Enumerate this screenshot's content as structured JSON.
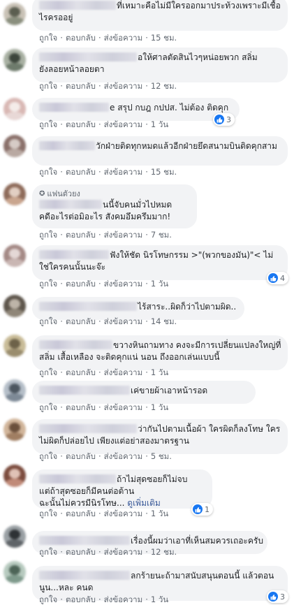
{
  "actions": {
    "like": "ถูกใจ",
    "reply": "ตอบกลับ",
    "message": "ส่งข้อความ",
    "dot": "·"
  },
  "comments": [
    {
      "lines": [
        "ที่เหมาะคือไม่มีใครออกมาประท้วงเพราะมีเชื้อ",
        "ไรครออยู่"
      ],
      "time": "15 ชม.",
      "colors": [
        "#8a8f7e",
        "#c9c2b6",
        "#5b5e50"
      ]
    },
    {
      "lines": [
        "อให้ศาลตัดสินไวๆหน่อยพวก สลิ่ม",
        "ยังลอยหน้าลอยตา"
      ],
      "time": "12 ชม.",
      "colors": [
        "#6e7b6c",
        "#a8b0a2",
        "#3d463c"
      ]
    },
    {
      "lines": [
        "e สรุป กบฎ กปปส. ไม่ต้อง ติดคุก"
      ],
      "time": "1 วัน",
      "reactions": "3",
      "colors": [
        "#e8d8d6",
        "#d9b8b4",
        "#f4ece9"
      ]
    },
    {
      "lines": [
        "วักฝ่ายติดทุกหมดแล้วอีกฝ่ายยึดสนามบินติดคุกสาม"
      ],
      "time": "15 ชม.",
      "colors": [
        "#b9a9a2",
        "#8a706a",
        "#d6cbc6"
      ]
    },
    {
      "badge": "แฟนตัวยง",
      "lines": [
        "นนี้จับคนมั่วไปหมด",
        "คดีอะไรต่อมิอะไร สังคมอึมครึมมาก!"
      ],
      "time": "7 ชม.",
      "colors": [
        "#c9a58e",
        "#8e6b5a",
        "#e2cfc3"
      ]
    },
    {
      "lines": [
        "ฟังให้ชัด นิรโทษกรรม >\"(พวกของมัน)\"< ไม่",
        "ใช่ใครคนนั้นนะจ๊ะ"
      ],
      "time": "1 วัน",
      "reactions": "4",
      "colors": [
        "#c9b6b3",
        "#a48985",
        "#e4d8d6"
      ]
    },
    {
      "lines": [
        "ไร้สาระ..ผิดก็ว่าไปตามผิด.."
      ],
      "time": "14 ชม.",
      "colors": [
        "#8f8678",
        "#5e564c",
        "#bdb4a8"
      ]
    },
    {
      "lines": [
        "ขวางหินถามทาง คงจะมีการเปลี่ยนแปลงใหญ่ที่",
        "สลิ่ม เสื้อเหลือง จะติดคุกแน่ นอน ถึงออกเล่นแบบนี้"
      ],
      "time": "1 วัน",
      "colors": [
        "#9a8d6e",
        "#c9bc98",
        "#6d6249"
      ]
    },
    {
      "lines": [
        "เค่ขายผ้าเอาหน้ารอด"
      ],
      "time": "1 วัน",
      "colors": [
        "#7d8996",
        "#b5bec8",
        "#4c5660"
      ]
    },
    {
      "lines": [
        "ว่ากันไปตามเนื้อผ้า ใครผิดก็ลงโทษ ใคร",
        "ไม่ผิดก็ปล่อยไป เพียงแต่อย่าสองมาตรฐาน"
      ],
      "time": "5 ชม.",
      "colors": [
        "#a07e62",
        "#d1b59a",
        "#6b503c"
      ]
    },
    {
      "lines": [
        "ถ้าไม่สุดซอยก็ไม่จบ",
        "แต่ถ้าสุดซอยก็มีคนต่อต้าน",
        "ฉะนั้นไม่ควรมีนิรโทษ..."
      ],
      "seemore": "ดูเพิ่มเติม",
      "time": "1 วัน",
      "reactions": "1",
      "colors": [
        "#c08a78",
        "#7c4c3e",
        "#e0c2b6"
      ]
    },
    {
      "lines": [
        "เรื่องนี้ผมว่าเอาที่เห็นสมควรเถอะครับ"
      ],
      "time": "12 ชม.",
      "colors": [
        "#5f6468",
        "#9aa0a4",
        "#2e3235"
      ]
    },
    {
      "lines": [
        "ลกร้ายนะถ้ามาสนับสนุนตอนนี้ แล้วตอน",
        "นูน...หละ คนด"
      ],
      "time": "1 วัน",
      "reactions": "3",
      "colors": [
        "#7f9a8c",
        "#b7cabf",
        "#4d6457"
      ]
    }
  ]
}
